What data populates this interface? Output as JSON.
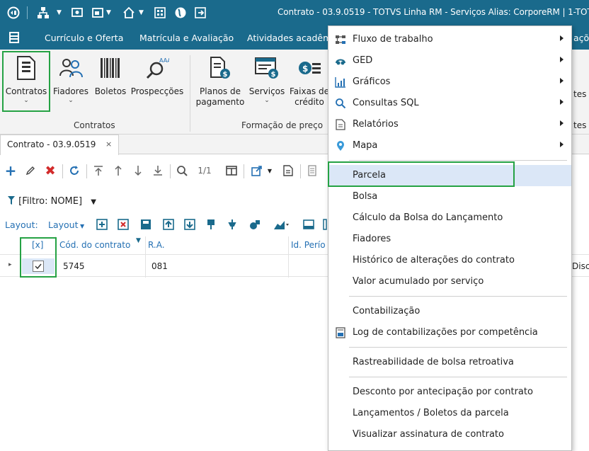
{
  "titlebar": {
    "title": "Contrato - 03.9.0519 - TOTVS Linha RM - Serviços  Alias: CorporeRM | 1-TOT",
    "icons": [
      "logo-icon",
      "org-chart-icon",
      "monitor-icon",
      "window-icon",
      "home-icon",
      "grid-icon",
      "globe-icon",
      "exit-icon"
    ]
  },
  "menubar": {
    "items": [
      "Currículo e Oferta",
      "Matrícula e Avaliação",
      "Atividades acadêmic",
      "ações"
    ]
  },
  "ribbon": {
    "buttons": [
      {
        "label": "Contratos",
        "icon": "document-icon"
      },
      {
        "label": "Fiadores",
        "icon": "users-icon"
      },
      {
        "label": "Boletos",
        "icon": "barcode-icon"
      },
      {
        "label": "Prospecções",
        "icon": "magnifier-icon"
      },
      {
        "label": "Planos de",
        "label2": "pagamento",
        "icon": "document-money-icon"
      },
      {
        "label": "Serviços",
        "icon": "services-icon"
      },
      {
        "label": "Faixas de",
        "label2": "crédito",
        "icon": "coins-icon"
      },
      {
        "label": "tes"
      },
      {
        "label": "tes"
      }
    ],
    "groups": [
      "Contratos",
      "Formação de preço"
    ],
    "accent": "#25a244"
  },
  "doc_tab": {
    "label": "Contrato - 03.9.0519",
    "close": "×"
  },
  "toolbar": {
    "pager": "1/1"
  },
  "filter": {
    "label": "[Filtro: NOME]"
  },
  "layout_bar": {
    "label1": "Layout:",
    "label2": "Layout"
  },
  "grid": {
    "headers": [
      "[x]",
      "Cód. do contrato",
      "R.A.",
      "Id. Perío"
    ],
    "rows": [
      {
        "code": "5745",
        "ra": "081",
        "extra": "Disci"
      }
    ]
  },
  "context_menu": {
    "items": [
      {
        "label": "Fluxo de trabalho",
        "icon": "workflow-icon",
        "submenu": true
      },
      {
        "label": "GED",
        "icon": "ged-icon",
        "submenu": true
      },
      {
        "label": "Gráficos",
        "icon": "chart-icon",
        "submenu": true
      },
      {
        "label": "Consultas SQL",
        "icon": "search-icon",
        "submenu": true
      },
      {
        "label": "Relatórios",
        "icon": "report-icon",
        "submenu": true
      },
      {
        "label": "Mapa",
        "icon": "map-pin-icon",
        "submenu": true
      },
      {
        "label": "Parcela",
        "highlighted": true
      },
      {
        "label": "Bolsa"
      },
      {
        "label": "Cálculo da Bolsa do Lançamento"
      },
      {
        "label": "Fiadores"
      },
      {
        "label": "Histórico de alterações do contrato"
      },
      {
        "label": "Valor acumulado por serviço"
      },
      {
        "label": "Contabilização"
      },
      {
        "label": "Log de contabilizações por competência",
        "icon": "log-icon"
      },
      {
        "label": "Rastreabilidade de bolsa retroativa"
      },
      {
        "label": "Desconto por antecipação por contrato"
      },
      {
        "label": "Lançamentos / Boletos da parcela"
      },
      {
        "label": "Visualizar assinatura de contrato"
      }
    ]
  },
  "colors": {
    "titlebar": "#1a6a8c",
    "highlight": "#dbe7f7",
    "link": "#2470b3",
    "delete": "#d22a2a"
  }
}
